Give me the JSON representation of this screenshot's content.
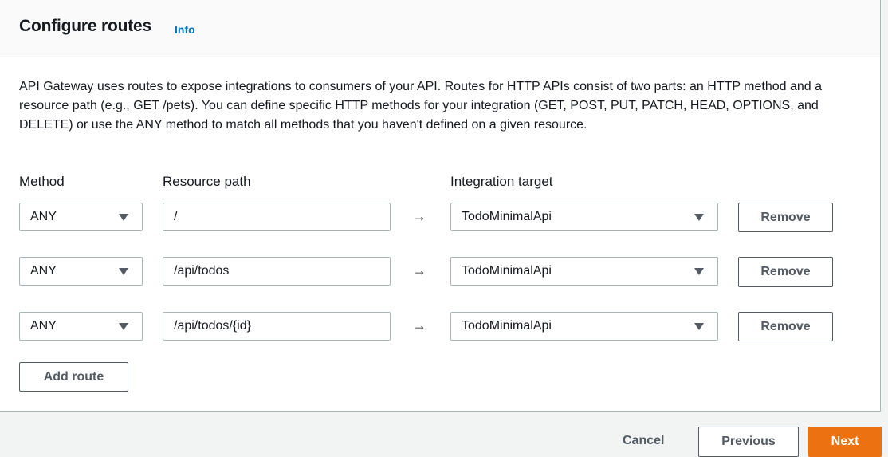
{
  "section": {
    "title": "Configure routes",
    "info_link": "Info",
    "description": "API Gateway uses routes to expose integrations to consumers of your API. Routes for HTTP APIs consist of two parts: an HTTP method and a resource path (e.g., GET /pets). You can define specific HTTP methods for your integration (GET, POST, PUT, PATCH, HEAD, OPTIONS, and DELETE) or use the ANY method to match all methods that you haven't defined on a given resource."
  },
  "columns": {
    "method": "Method",
    "resource_path": "Resource path",
    "integration_target": "Integration target"
  },
  "routes": [
    {
      "method": "ANY",
      "path": "/",
      "arrow": "→",
      "target": "TodoMinimalApi",
      "remove_label": "Remove"
    },
    {
      "method": "ANY",
      "path": "/api/todos",
      "arrow": "→",
      "target": "TodoMinimalApi",
      "remove_label": "Remove"
    },
    {
      "method": "ANY",
      "path": "/api/todos/{id}",
      "arrow": "→",
      "target": "TodoMinimalApi",
      "remove_label": "Remove"
    }
  ],
  "add_route_label": "Add route",
  "footer": {
    "cancel_label": "Cancel",
    "previous_label": "Previous",
    "next_label": "Next"
  },
  "colors": {
    "primary": "#ec7211",
    "link": "#0073bb",
    "border": "#aab7b8",
    "text": "#16191f",
    "secondary_text": "#545b64"
  },
  "icons": {
    "dropdown": "caret-down-icon",
    "route_arrow": "right-arrow-icon"
  }
}
